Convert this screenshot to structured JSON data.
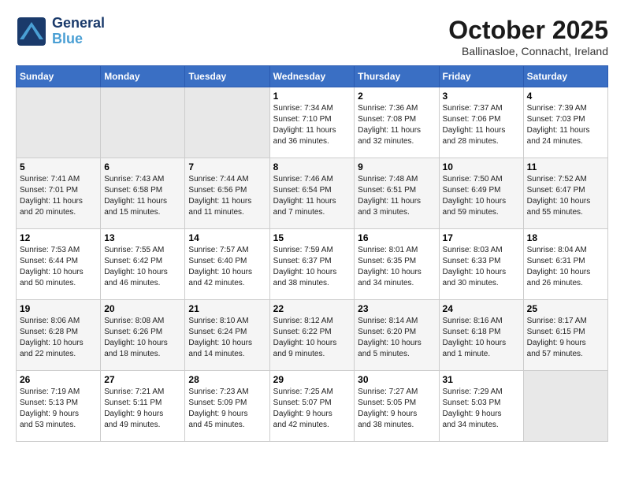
{
  "logo": {
    "line1": "General",
    "line2": "Blue"
  },
  "title": "October 2025",
  "subtitle": "Ballinasloe, Connacht, Ireland",
  "weekdays": [
    "Sunday",
    "Monday",
    "Tuesday",
    "Wednesday",
    "Thursday",
    "Friday",
    "Saturday"
  ],
  "weeks": [
    [
      {
        "day": "",
        "info": ""
      },
      {
        "day": "",
        "info": ""
      },
      {
        "day": "",
        "info": ""
      },
      {
        "day": "1",
        "info": "Sunrise: 7:34 AM\nSunset: 7:10 PM\nDaylight: 11 hours\nand 36 minutes."
      },
      {
        "day": "2",
        "info": "Sunrise: 7:36 AM\nSunset: 7:08 PM\nDaylight: 11 hours\nand 32 minutes."
      },
      {
        "day": "3",
        "info": "Sunrise: 7:37 AM\nSunset: 7:06 PM\nDaylight: 11 hours\nand 28 minutes."
      },
      {
        "day": "4",
        "info": "Sunrise: 7:39 AM\nSunset: 7:03 PM\nDaylight: 11 hours\nand 24 minutes."
      }
    ],
    [
      {
        "day": "5",
        "info": "Sunrise: 7:41 AM\nSunset: 7:01 PM\nDaylight: 11 hours\nand 20 minutes."
      },
      {
        "day": "6",
        "info": "Sunrise: 7:43 AM\nSunset: 6:58 PM\nDaylight: 11 hours\nand 15 minutes."
      },
      {
        "day": "7",
        "info": "Sunrise: 7:44 AM\nSunset: 6:56 PM\nDaylight: 11 hours\nand 11 minutes."
      },
      {
        "day": "8",
        "info": "Sunrise: 7:46 AM\nSunset: 6:54 PM\nDaylight: 11 hours\nand 7 minutes."
      },
      {
        "day": "9",
        "info": "Sunrise: 7:48 AM\nSunset: 6:51 PM\nDaylight: 11 hours\nand 3 minutes."
      },
      {
        "day": "10",
        "info": "Sunrise: 7:50 AM\nSunset: 6:49 PM\nDaylight: 10 hours\nand 59 minutes."
      },
      {
        "day": "11",
        "info": "Sunrise: 7:52 AM\nSunset: 6:47 PM\nDaylight: 10 hours\nand 55 minutes."
      }
    ],
    [
      {
        "day": "12",
        "info": "Sunrise: 7:53 AM\nSunset: 6:44 PM\nDaylight: 10 hours\nand 50 minutes."
      },
      {
        "day": "13",
        "info": "Sunrise: 7:55 AM\nSunset: 6:42 PM\nDaylight: 10 hours\nand 46 minutes."
      },
      {
        "day": "14",
        "info": "Sunrise: 7:57 AM\nSunset: 6:40 PM\nDaylight: 10 hours\nand 42 minutes."
      },
      {
        "day": "15",
        "info": "Sunrise: 7:59 AM\nSunset: 6:37 PM\nDaylight: 10 hours\nand 38 minutes."
      },
      {
        "day": "16",
        "info": "Sunrise: 8:01 AM\nSunset: 6:35 PM\nDaylight: 10 hours\nand 34 minutes."
      },
      {
        "day": "17",
        "info": "Sunrise: 8:03 AM\nSunset: 6:33 PM\nDaylight: 10 hours\nand 30 minutes."
      },
      {
        "day": "18",
        "info": "Sunrise: 8:04 AM\nSunset: 6:31 PM\nDaylight: 10 hours\nand 26 minutes."
      }
    ],
    [
      {
        "day": "19",
        "info": "Sunrise: 8:06 AM\nSunset: 6:28 PM\nDaylight: 10 hours\nand 22 minutes."
      },
      {
        "day": "20",
        "info": "Sunrise: 8:08 AM\nSunset: 6:26 PM\nDaylight: 10 hours\nand 18 minutes."
      },
      {
        "day": "21",
        "info": "Sunrise: 8:10 AM\nSunset: 6:24 PM\nDaylight: 10 hours\nand 14 minutes."
      },
      {
        "day": "22",
        "info": "Sunrise: 8:12 AM\nSunset: 6:22 PM\nDaylight: 10 hours\nand 9 minutes."
      },
      {
        "day": "23",
        "info": "Sunrise: 8:14 AM\nSunset: 6:20 PM\nDaylight: 10 hours\nand 5 minutes."
      },
      {
        "day": "24",
        "info": "Sunrise: 8:16 AM\nSunset: 6:18 PM\nDaylight: 10 hours\nand 1 minute."
      },
      {
        "day": "25",
        "info": "Sunrise: 8:17 AM\nSunset: 6:15 PM\nDaylight: 9 hours\nand 57 minutes."
      }
    ],
    [
      {
        "day": "26",
        "info": "Sunrise: 7:19 AM\nSunset: 5:13 PM\nDaylight: 9 hours\nand 53 minutes."
      },
      {
        "day": "27",
        "info": "Sunrise: 7:21 AM\nSunset: 5:11 PM\nDaylight: 9 hours\nand 49 minutes."
      },
      {
        "day": "28",
        "info": "Sunrise: 7:23 AM\nSunset: 5:09 PM\nDaylight: 9 hours\nand 45 minutes."
      },
      {
        "day": "29",
        "info": "Sunrise: 7:25 AM\nSunset: 5:07 PM\nDaylight: 9 hours\nand 42 minutes."
      },
      {
        "day": "30",
        "info": "Sunrise: 7:27 AM\nSunset: 5:05 PM\nDaylight: 9 hours\nand 38 minutes."
      },
      {
        "day": "31",
        "info": "Sunrise: 7:29 AM\nSunset: 5:03 PM\nDaylight: 9 hours\nand 34 minutes."
      },
      {
        "day": "",
        "info": ""
      }
    ]
  ]
}
